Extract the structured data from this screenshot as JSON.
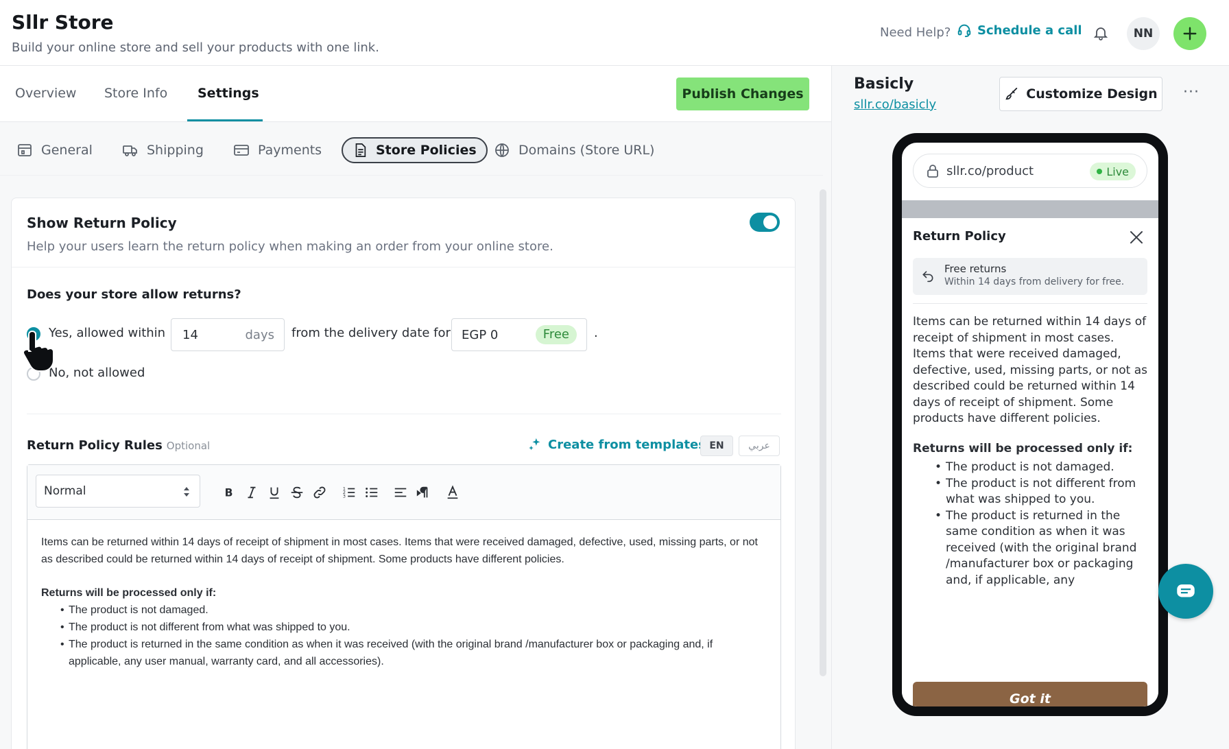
{
  "header": {
    "app_title": "Sllr Store",
    "app_subtitle": "Build your online store and sell your products with one link.",
    "need_help": "Need Help?",
    "schedule_call": "Schedule a call",
    "avatar_initials": "NN"
  },
  "tabs": {
    "items": [
      "Overview",
      "Store Info",
      "Settings"
    ],
    "active": "Settings",
    "publish_label": "Publish Changes"
  },
  "subtabs": {
    "items": [
      {
        "label": "General",
        "icon": "store-icon"
      },
      {
        "label": "Shipping",
        "icon": "truck-icon"
      },
      {
        "label": "Payments",
        "icon": "card-icon"
      },
      {
        "label": "Store Policies",
        "icon": "document-icon"
      },
      {
        "label": "Domains (Store URL)",
        "icon": "globe-icon"
      }
    ],
    "active": "Store Policies"
  },
  "return_policy": {
    "title": "Show Return Policy",
    "description": "Help your users learn the return policy when making an order from your online store.",
    "enabled": true,
    "question": "Does your store allow returns?",
    "option_yes": "Yes, allowed within",
    "days_value": "14",
    "days_unit": "days",
    "from_delivery": "from the delivery date for",
    "fee_value": "EGP 0",
    "fee_badge": "Free",
    "period": ".",
    "option_no": "No, not allowed",
    "selected": "yes"
  },
  "rules": {
    "title": "Return Policy Rules",
    "optional": "Optional",
    "templates_label": "Create from templates",
    "lang_en": "EN",
    "lang_ar": "عربي",
    "format_select": "Normal",
    "paragraph": "Items can be returned within 14 days of receipt of shipment in most cases. Items that were received damaged, defective, used, missing parts, or not as described could be returned within 14 days of receipt of shipment. Some products have different policies.",
    "heading": "Returns will be processed only if:",
    "bullets": [
      "The product is not damaged.",
      "The product is not different from what was shipped to you.",
      "The product is returned in the same condition as when it was received (with the original brand /manufacturer box or packaging and, if applicable, any user manual, warranty card, and all accessories)."
    ]
  },
  "preview": {
    "store_name": "Basicly",
    "store_link": "sllr.co/basicly",
    "customize_label": "Customize Design",
    "more_label": "···",
    "url": "sllr.co/product",
    "live": "Live",
    "modal_title": "Return Policy",
    "free_returns_title": "Free returns",
    "free_returns_sub": "Within 14 days from delivery for free.",
    "paragraph": "Items can be returned within 14 days of receipt of shipment in most cases. Items that were received damaged, defective, used, missing parts, or not as described could be returned within 14 days of receipt of shipment. Some products have different policies.",
    "heading": "Returns will be processed only if:",
    "bullets": [
      "The product is not damaged.",
      "The product is not different from what was shipped to you.",
      "The product is returned in the same condition as when it was received (with the original brand /manufacturer box or packaging and, if applicable, any"
    ],
    "got_it": "Got it"
  },
  "colors": {
    "accent": "#0d8fa2",
    "publish_green": "#85e37a",
    "got_it_brown": "#8b6444"
  }
}
